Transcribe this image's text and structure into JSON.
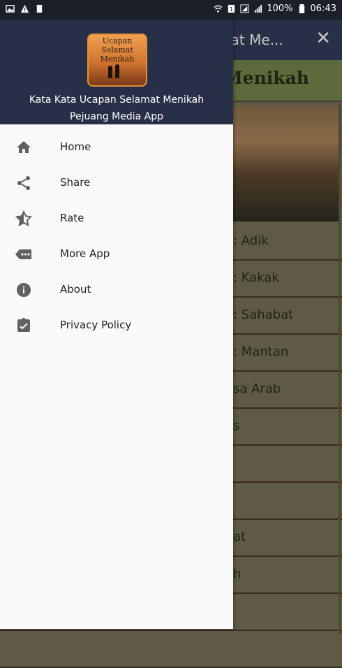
{
  "status_bar": {
    "battery": "100%",
    "time": "06:43"
  },
  "background_app": {
    "toolbar_title": "nat Me...",
    "heading": "Menikah",
    "list_items": [
      ": Adik",
      ": Kakak",
      ": Sahabat",
      ": Mantan",
      "sa Arab",
      "s",
      "",
      "",
      "at",
      "h",
      "",
      ""
    ]
  },
  "drawer": {
    "logo_text": [
      "Ucapan",
      "Selamat",
      "Menikah"
    ],
    "title": "Kata Kata Ucapan Selamat Menikah",
    "subtitle": "Pejuang Media App",
    "items": [
      {
        "label": "Home",
        "icon": "home-icon"
      },
      {
        "label": "Share",
        "icon": "share-icon"
      },
      {
        "label": "Rate",
        "icon": "star-half-icon"
      },
      {
        "label": "More App",
        "icon": "more-app-icon"
      },
      {
        "label": "About",
        "icon": "info-icon"
      },
      {
        "label": "Privacy Policy",
        "icon": "clipboard-check-icon"
      }
    ]
  },
  "colors": {
    "header_bg": "#283048",
    "icon_gray": "#757575",
    "scrim": "#5f5a45"
  }
}
